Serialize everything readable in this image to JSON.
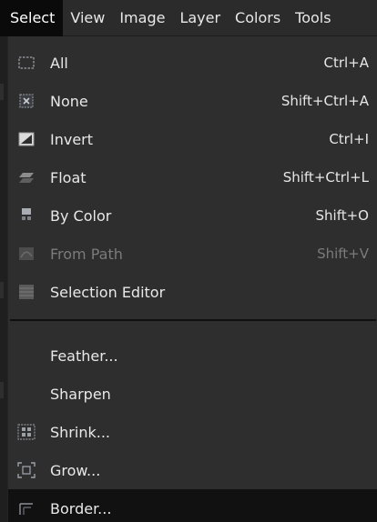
{
  "menubar": {
    "items": [
      {
        "label": "Select"
      },
      {
        "label": "View"
      },
      {
        "label": "Image"
      },
      {
        "label": "Layer"
      },
      {
        "label": "Colors"
      },
      {
        "label": "Tools"
      }
    ],
    "active_index": 0
  },
  "select_menu": {
    "items": [
      {
        "label": "All",
        "shortcut": "Ctrl+A",
        "icon": "select-all-icon",
        "enabled": true
      },
      {
        "label": "None",
        "shortcut": "Shift+Ctrl+A",
        "icon": "select-none-icon",
        "enabled": true
      },
      {
        "label": "Invert",
        "shortcut": "Ctrl+I",
        "icon": "invert-selection-icon",
        "enabled": true
      },
      {
        "label": "Float",
        "shortcut": "Shift+Ctrl+L",
        "icon": "float-selection-icon",
        "enabled": true
      },
      {
        "label": "By Color",
        "shortcut": "Shift+O",
        "icon": "select-by-color-icon",
        "enabled": true
      },
      {
        "label": "From Path",
        "shortcut": "Shift+V",
        "icon": "selection-from-path-icon",
        "enabled": false
      },
      {
        "label": "Selection Editor",
        "shortcut": "",
        "icon": "selection-editor-icon",
        "enabled": true
      },
      {
        "label": "Feather...",
        "shortcut": "",
        "icon": "",
        "enabled": true
      },
      {
        "label": "Sharpen",
        "shortcut": "",
        "icon": "",
        "enabled": true
      },
      {
        "label": "Shrink...",
        "shortcut": "",
        "icon": "shrink-selection-icon",
        "enabled": true
      },
      {
        "label": "Grow...",
        "shortcut": "",
        "icon": "grow-selection-icon",
        "enabled": true
      },
      {
        "label": "Border...",
        "shortcut": "",
        "icon": "border-selection-icon",
        "enabled": true
      }
    ],
    "highlighted_index": 11
  },
  "colors": {
    "menubar_bg": "#2b2b2b",
    "menu_bg": "#2e2e2e",
    "highlight_bg": "#111111",
    "text": "#e8e8e8",
    "disabled_text": "#7b7b7b"
  }
}
